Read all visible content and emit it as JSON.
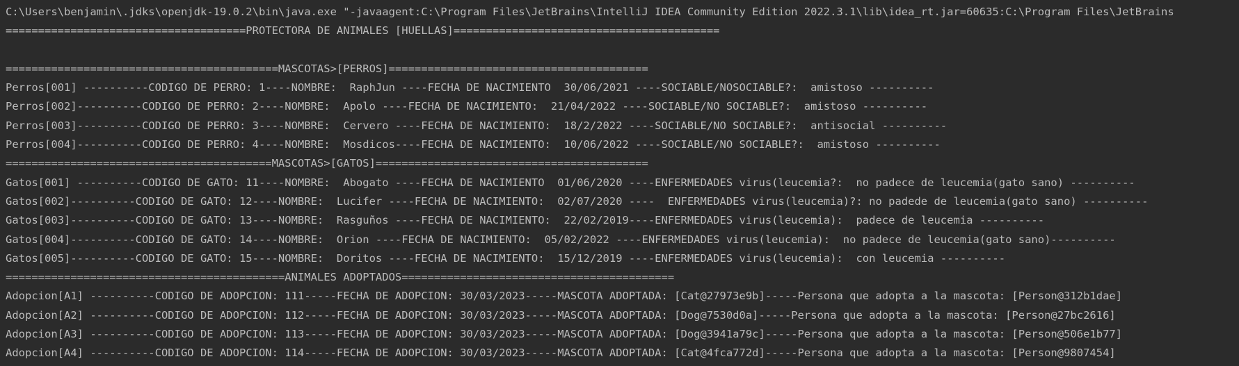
{
  "console": {
    "lines": [
      "C:\\Users\\benjamin\\.jdks\\openjdk-19.0.2\\bin\\java.exe \"-javaagent:C:\\Program Files\\JetBrains\\IntelliJ IDEA Community Edition 2022.3.1\\lib\\idea_rt.jar=60635:C:\\Program Files\\JetBrains",
      "=====================================PROTECTORA DE ANIMALES [HUELLAS]=========================================",
      "",
      "==========================================MASCOTAS>[PERROS]========================================",
      "Perros[001] ----------CODIGO DE PERRO: 1----NOMBRE:  RaphJun ----FECHA DE NACIMIENTO  30/06/2021 ----SOCIABLE/NOSOCIABLE?:  amistoso ----------",
      "Perros[002]----------CODIGO DE PERRO: 2----NOMBRE:  Apolo ----FECHA DE NACIMIENTO:  21/04/2022 ----SOCIABLE/NO SOCIABLE?:  amistoso ----------",
      "Perros[003]----------CODIGO DE PERRO: 3----NOMBRE:  Cervero ----FECHA DE NACIMIENTO:  18/2/2022 ----SOCIABLE/NO SOCIABLE?:  antisocial ----------",
      "Perros[004]----------CODIGO DE PERRO: 4----NOMBRE:  Mosdicos----FECHA DE NACIMIENTO:  10/06/2022 ----SOCIABLE/NO SOCIABLE?:  amistoso ----------",
      "=========================================MASCOTAS>[GATOS]==========================================",
      "Gatos[001] ----------CODIGO DE GATO: 11----NOMBRE:  Abogato ----FECHA DE NACIMIENTO  01/06/2020 ----ENFERMEDADES virus(leucemia?:  no padece de leucemia(gato sano) ----------",
      "Gatos[002]----------CODIGO DE GATO: 12----NOMBRE:  Lucifer ----FECHA DE NACIMIENTO:  02/07/2020 ----  ENFERMEDADES virus(leucemia)?: no padede de leucemia(gato sano) ----------",
      "Gatos[003]----------CODIGO DE GATO: 13----NOMBRE:  Rasguños ----FECHA DE NACIMIENTO:  22/02/2019----ENFERMEDADES virus(leucemia):  padece de leucemia ----------",
      "Gatos[004]----------CODIGO DE GATO: 14----NOMBRE:  Orion ----FECHA DE NACIMIENTO:  05/02/2022 ----ENFERMEDADES virus(leucemia):  no padece de leucemia(gato sano)----------",
      "Gatos[005]----------CODIGO DE GATO: 15----NOMBRE:  Doritos ----FECHA DE NACIMIENTO:  15/12/2019 ----ENFERMEDADES virus(leucemia):  con leucemia ----------",
      "===========================================ANIMALES ADOPTADOS==========================================",
      "Adopcion[A1] ----------CODIGO DE ADOPCION: 111-----FECHA DE ADOPCION: 30/03/2023-----MASCOTA ADOPTADA: [Cat@27973e9b]-----Persona que adopta a la mascota: [Person@312b1dae]",
      "Adopcion[A2] ----------CODIGO DE ADOPCION: 112-----FECHA DE ADOPCION: 30/03/2023-----MASCOTA ADOPTADA: [Dog@7530d0a]-----Persona que adopta a la mascota: [Person@27bc2616]",
      "Adopcion[A3] ----------CODIGO DE ADOPCION: 113-----FECHA DE ADOPCION: 30/03/2023-----MASCOTA ADOPTADA: [Dog@3941a79c]-----Persona que adopta a la mascota: [Person@506e1b77]",
      "Adopcion[A4] ----------CODIGO DE ADOPCION: 114-----FECHA DE ADOPCION: 30/03/2023-----MASCOTA ADOPTADA: [Cat@4fca772d]-----Persona que adopta a la mascota: [Person@9807454]"
    ]
  }
}
